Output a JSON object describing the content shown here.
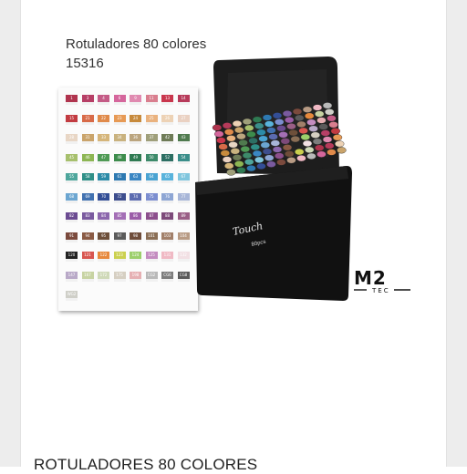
{
  "image": {
    "title_line1": "Rotuladores 80 colores",
    "title_line2": "15316",
    "bag_brand": "Touch",
    "bag_count": "80pcs",
    "logo_main": "M2",
    "logo_sub": "TEC"
  },
  "product": {
    "name": "ROTULADORES 80 COLORES"
  },
  "swatches": {
    "rows": [
      [
        "1",
        "3",
        "4",
        "6",
        "9",
        "11",
        "13",
        "14"
      ],
      [
        "15",
        "21",
        "22",
        "23",
        "24",
        "25",
        "26",
        "27"
      ],
      [
        "28",
        "31",
        "33",
        "34",
        "36",
        "37",
        "42",
        "43"
      ],
      [
        "45",
        "46",
        "47",
        "48",
        "49",
        "50",
        "52",
        "54"
      ],
      [
        "55",
        "58",
        "59",
        "61",
        "63",
        "64",
        "65",
        "67"
      ],
      [
        "68",
        "69",
        "70",
        "72",
        "74",
        "75",
        "76",
        "77"
      ],
      [
        "82",
        "83",
        "84",
        "85",
        "86",
        "87",
        "88",
        "89"
      ],
      [
        "91",
        "94",
        "95",
        "97",
        "98",
        "101",
        "103",
        "104"
      ],
      [
        "120",
        "121",
        "122",
        "123",
        "124",
        "125",
        "131",
        "132"
      ],
      [
        "147",
        "167",
        "172",
        "175",
        "198",
        "CG2",
        "CG6",
        "CG8"
      ],
      [
        "WG2"
      ]
    ],
    "colors": [
      [
        "#b0344e",
        "#b73f66",
        "#c45b86",
        "#d5669c",
        "#e08ab0",
        "#d97e8e",
        "#c9364d",
        "#b73a5a"
      ],
      [
        "#c23b41",
        "#d86a48",
        "#e08a4a",
        "#e79a55",
        "#c78a3c",
        "#eab27e",
        "#edd2b5",
        "#ead1c2"
      ],
      [
        "#e8d6c5",
        "#caa46b",
        "#d5b57a",
        "#c9b27f",
        "#bba57f",
        "#9f9f7a",
        "#6e7b57",
        "#4f7a4e"
      ],
      [
        "#a7c06d",
        "#8db653",
        "#4f9a55",
        "#3d8c4c",
        "#2f7a52",
        "#3d8a6a",
        "#2d6f63",
        "#3b8e8a"
      ],
      [
        "#4ea69c",
        "#2f8f87",
        "#2c8ba8",
        "#2e79b1",
        "#3a86c3",
        "#4aa3d2",
        "#59b3dc",
        "#80c6de"
      ],
      [
        "#6ca6d1",
        "#4171b0",
        "#334e96",
        "#3e4e8e",
        "#5b6bb0",
        "#7c8ed0",
        "#8ea6d4",
        "#a8b6d8"
      ],
      [
        "#6b4b91",
        "#7a5a9f",
        "#8c67ad",
        "#a46fb6",
        "#9b5da8",
        "#8c4f8c",
        "#7d4a7a",
        "#9a5f86"
      ],
      [
        "#7b4a3d",
        "#8a5a44",
        "#6d4f3a",
        "#5b5b5b",
        "#6f4d3a",
        "#8a6e55",
        "#a2806a",
        "#b89b84"
      ],
      [
        "#222222",
        "#d8554f",
        "#e7893c",
        "#cbd04f",
        "#9ccf6b",
        "#c48cc0",
        "#f0b9c4",
        "#f2e0e4"
      ],
      [
        "#b9a9c8",
        "#c7d3a2",
        "#cfd9b8",
        "#d6cfc2",
        "#e6b0b3",
        "#b9b9b9",
        "#7d7d7d",
        "#5a5a5a"
      ],
      [
        "#cfcfc8"
      ]
    ]
  }
}
